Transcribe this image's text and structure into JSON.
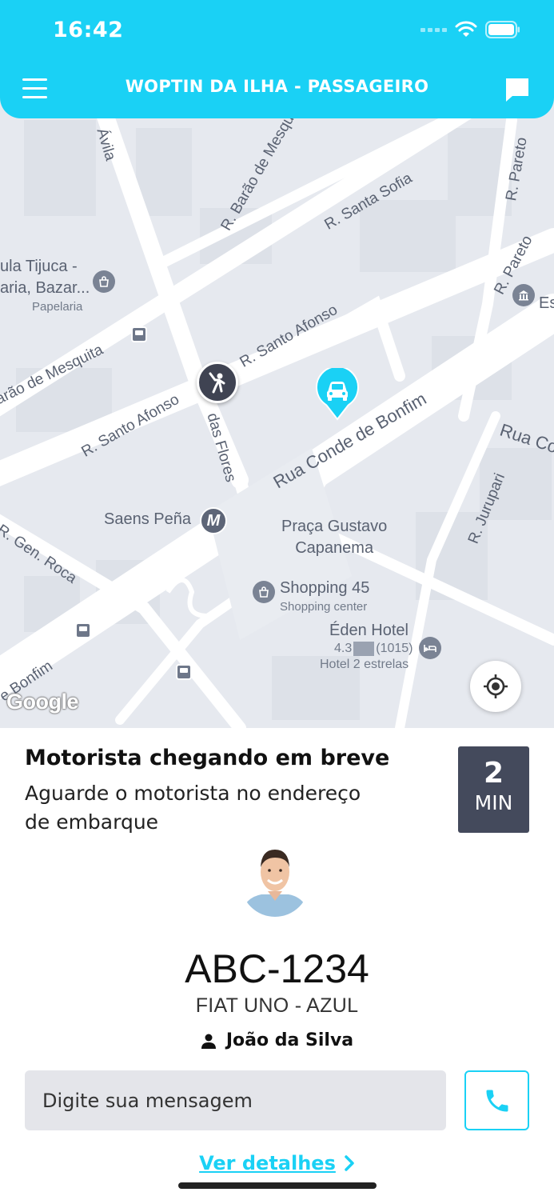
{
  "status_bar": {
    "time": "16:42"
  },
  "header": {
    "title": "WOPTIN DA ILHA - PASSAGEIRO",
    "menu_icon": "hamburger-menu-icon",
    "chat_icon": "chat-bubble-icon"
  },
  "map": {
    "streets": [
      "Ávila",
      "R. Barão de Mesquita",
      "R. Santa Sofia",
      "R. Pareto",
      "R. Pareto",
      "arão de Mesquita",
      "R. Santo Afonso",
      "R. Santo Afonso",
      "das Flores",
      "Rua Conde de Bonfim",
      "Rua Co",
      "R. Jurupari",
      "R. Gen. Roca",
      "e Bonfim"
    ],
    "pois": {
      "papelaria": {
        "name_line1": "ula Tijuca -",
        "name_line2": "aria, Bazar...",
        "category": "Papelaria"
      },
      "esq": {
        "name": "Es"
      },
      "saens_pena": {
        "name": "Saens Peña"
      },
      "praca": {
        "line1": "Praça Gustavo",
        "line2": "Capanema"
      },
      "shopping": {
        "name": "Shopping 45",
        "category": "Shopping center"
      },
      "hotel": {
        "name": "Éden Hotel",
        "rating": "4.3",
        "reviews": "(1015)",
        "category": "Hotel 2 estrelas"
      }
    },
    "attribution": "Google",
    "locate_icon": "my-location-icon"
  },
  "arrival": {
    "title": "Motorista chegando em breve",
    "subtitle": "Aguarde o motorista no endereço de embarque",
    "eta_value": "2",
    "eta_unit": "MIN"
  },
  "driver": {
    "plate": "ABC-1234",
    "car": "FIAT UNO - AZUL",
    "name": "João da Silva"
  },
  "message": {
    "placeholder": "Digite sua mensagem"
  },
  "details_link": "Ver detalhes",
  "colors": {
    "primary": "#1ad1f5",
    "eta_bg": "#444a5c",
    "map_bg": "#e6e9ef"
  }
}
